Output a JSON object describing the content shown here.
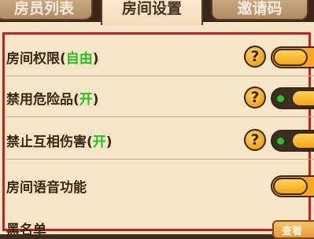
{
  "tabs": {
    "members": "房员列表",
    "settings": "房间设置",
    "invite": "邀请码"
  },
  "settings": [
    {
      "label": "房间权限(",
      "status": "自由",
      "close": ")",
      "help": "?",
      "toggle": "off"
    },
    {
      "label": "禁用危险品(",
      "status": "开",
      "close": ")",
      "help": "?",
      "toggle": "on"
    },
    {
      "label": "禁止互相伤害(",
      "status": "开",
      "close": ")",
      "help": "?",
      "toggle": "on"
    },
    {
      "label": "房间语音功能",
      "status": "",
      "close": "",
      "toggle": "off"
    }
  ],
  "blacklist": {
    "label": "黑名单",
    "view_button": "查看"
  },
  "colors": {
    "highlight_border": "#d21c1c",
    "status_text": "#22c21a",
    "toggle_orange": "#f5a91f",
    "panel_bg": "#f6e6c8"
  }
}
